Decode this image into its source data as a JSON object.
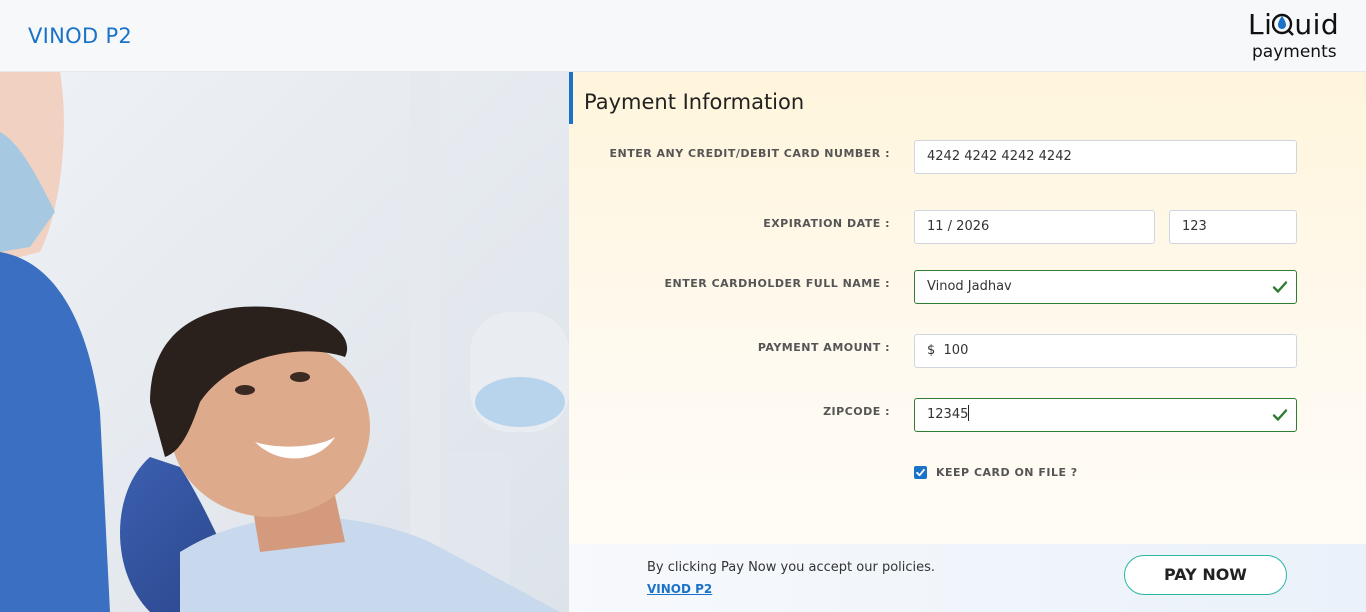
{
  "header": {
    "brand": "VINOD P2",
    "logo": {
      "top_pre": "Li",
      "top_post": "uid",
      "bottom": "payments"
    }
  },
  "colors": {
    "accent": "#1a73c8",
    "valid": "#2e7d32",
    "button_border": "#2ab5a5"
  },
  "form": {
    "title": "Payment Information",
    "card_label": "ENTER ANY CREDIT/DEBIT CARD NUMBER :",
    "card_value": "4242 4242 4242 4242",
    "exp_label": "EXPIRATION DATE :",
    "exp_value": "11 / 2026",
    "cvv_value": "123",
    "name_label": "ENTER CARDHOLDER FULL NAME :",
    "name_value": "Vinod Jadhav",
    "amount_label": "PAYMENT AMOUNT :",
    "amount_value": "$  100",
    "zip_label": "ZIPCODE :",
    "zip_value": "12345",
    "keep_card_label": "KEEP CARD ON FILE ?",
    "keep_card_checked": true
  },
  "footer": {
    "policy_text": "By clicking Pay Now you accept our policies.",
    "policy_link": "VINOD P2",
    "pay_button": "PAY NOW"
  },
  "icons": {
    "valid": "check-icon",
    "checkbox": "checkbox-checked-icon"
  }
}
